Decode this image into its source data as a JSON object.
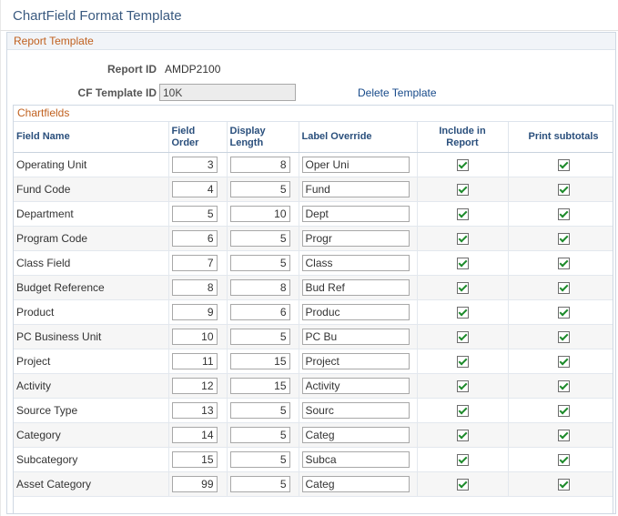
{
  "page": {
    "title": "ChartField Format Template"
  },
  "report_template": {
    "section_title": "Report Template",
    "report_id_label": "Report ID",
    "report_id_value": "AMDP2100",
    "cf_template_label": "CF Template ID",
    "cf_template_value": "10K",
    "delete_link": "Delete Template"
  },
  "chartfields": {
    "section_title": "Chartfields",
    "columns": {
      "field_name": "Field Name",
      "field_order_1": "Field",
      "field_order_2": "Order",
      "display_length_1": "Display",
      "display_length_2": "Length",
      "label_override": "Label Override",
      "include_1": "Include in",
      "include_2": "Report",
      "print_subtotals": "Print subtotals"
    },
    "rows": [
      {
        "name": "Operating Unit",
        "order": "3",
        "length": "8",
        "label": "Oper Uni",
        "include": true,
        "subtotal": true
      },
      {
        "name": "Fund Code",
        "order": "4",
        "length": "5",
        "label": "Fund",
        "include": true,
        "subtotal": true
      },
      {
        "name": "Department",
        "order": "5",
        "length": "10",
        "label": "Dept",
        "include": true,
        "subtotal": true
      },
      {
        "name": "Program Code",
        "order": "6",
        "length": "5",
        "label": "Progr",
        "include": true,
        "subtotal": true
      },
      {
        "name": "Class Field",
        "order": "7",
        "length": "5",
        "label": "Class",
        "include": true,
        "subtotal": true
      },
      {
        "name": "Budget Reference",
        "order": "8",
        "length": "8",
        "label": "Bud Ref",
        "include": true,
        "subtotal": true
      },
      {
        "name": "Product",
        "order": "9",
        "length": "6",
        "label": "Produc",
        "include": true,
        "subtotal": true
      },
      {
        "name": "PC Business Unit",
        "order": "10",
        "length": "5",
        "label": "PC Bu",
        "include": true,
        "subtotal": true
      },
      {
        "name": "Project",
        "order": "11",
        "length": "15",
        "label": "Project",
        "include": true,
        "subtotal": true
      },
      {
        "name": "Activity",
        "order": "12",
        "length": "15",
        "label": "Activity",
        "include": true,
        "subtotal": true
      },
      {
        "name": "Source Type",
        "order": "13",
        "length": "5",
        "label": "Sourc",
        "include": true,
        "subtotal": true
      },
      {
        "name": "Category",
        "order": "14",
        "length": "5",
        "label": "Categ",
        "include": true,
        "subtotal": true
      },
      {
        "name": "Subcategory",
        "order": "15",
        "length": "5",
        "label": "Subca",
        "include": true,
        "subtotal": true
      },
      {
        "name": "Asset Category",
        "order": "99",
        "length": "5",
        "label": "Categ",
        "include": true,
        "subtotal": true
      }
    ]
  }
}
